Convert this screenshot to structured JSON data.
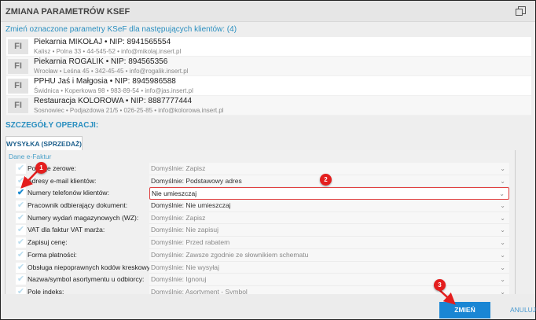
{
  "window": {
    "title": "ZMIANA PARAMETRÓW KSEF"
  },
  "subtitle": "Zmień oznaczone parametry KSeF dla następujących klientów: (4)",
  "clients": [
    {
      "badge": "FI",
      "name": "Piekarnia MIKOŁAJ • NIP: 8941565554",
      "details": "Kalisz • Polna  33  • 44-545-52 • info@mikolaj.insert.pl"
    },
    {
      "badge": "FI",
      "name": "Piekarnia ROGALIK • NIP: 894565356",
      "details": "Wrocław • Leśna  45  • 342-45-45 • info@rogalik.insert.pl"
    },
    {
      "badge": "FI",
      "name": "PPHU Jaś i Małgosia • NIP: 8945986588",
      "details": "Świdnica • Koperkowa  98  • 983-89-54 • info@jas.insert.pl"
    },
    {
      "badge": "FI",
      "name": "Restauracja KOLOROWA • NIP: 8887777444",
      "details": "Sosnowiec • Podjazdowa  21/5  • 026-25-85 • info@kolorowa.insert.pl"
    }
  ],
  "section": "SZCZEGÓŁY OPERACJI:",
  "tab": "WYSYŁKA (SPRZEDAŻ)",
  "group": "Dane e-Faktur",
  "rows": [
    {
      "label": "Pozycje zerowe:",
      "value": "Domyślnie: Zapisz",
      "checked": false
    },
    {
      "label": "Adresy e-mail klientów:",
      "value": "Domyślnie: Podstawowy adres",
      "checked": false
    },
    {
      "label": "Numery telefonów klientów:",
      "value": "Nie umieszczaj",
      "checked": true
    },
    {
      "label": "Pracownik odbierający dokument:",
      "value": "Domyślnie: Nie umieszczaj",
      "checked": false
    },
    {
      "label": "Numery wydań magazynowych (WZ):",
      "value": "Domyślnie: Zapisz",
      "checked": false
    },
    {
      "label": "VAT dla faktur VAT marża:",
      "value": "Domyślnie: Nie zapisuj",
      "checked": false
    },
    {
      "label": "Zapisuj cenę:",
      "value": "Domyślnie: Przed rabatem",
      "checked": false
    },
    {
      "label": "Forma płatności:",
      "value": "Domyślnie: Zawsze zgodnie ze słownikiem schematu",
      "checked": false
    },
    {
      "label": "Obsługa niepoprawnych kodów kreskowych:",
      "value": "Domyślnie: Nie wysyłaj",
      "checked": false
    },
    {
      "label": "Nazwa/symbol asortymentu u odbiorcy:",
      "value": "Domyślnie: Ignoruj",
      "checked": false
    },
    {
      "label": "Pole indeks:",
      "value": "Domyślnie: Asortyment - Symbol",
      "checked": false
    }
  ],
  "buttons": {
    "confirm": "ZMIEŃ",
    "cancel": "ANULUJ"
  },
  "annotations": [
    "1",
    "2",
    "3"
  ],
  "colors": {
    "accent": "#2a8fc0",
    "button": "#1a86d4",
    "annotation": "#e41e1e"
  }
}
